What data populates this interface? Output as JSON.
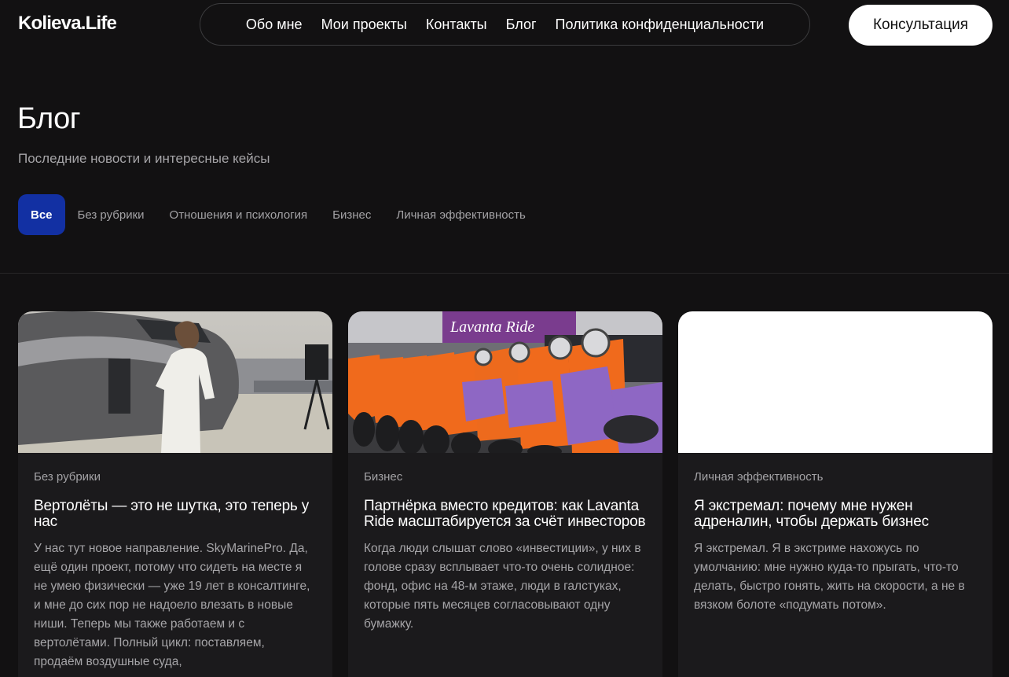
{
  "header": {
    "logo": "Kolieva.Life",
    "nav": [
      "Обо мне",
      "Мои проекты",
      "Контакты",
      "Блог",
      "Политика конфиденциальности"
    ],
    "cta": "Консультация"
  },
  "hero": {
    "title": "Блог",
    "subtitle": "Последние новости и интересные кейсы"
  },
  "filters": [
    "Все",
    "Без рубрики",
    "Отношения и психология",
    "Бизнес",
    "Личная эффективность"
  ],
  "active_filter": "Все",
  "posts": [
    {
      "category": "Без рубрики",
      "title": "Вертолёты — это не шутка, это теперь у нас",
      "excerpt": "У нас тут новое направление. SkyMarinePro. Да, ещё один проект, потому что сидеть на месте я не умею физически — уже 19 лет в консалтинге, и мне до сих пор не надоело влезать в новые ниши. Теперь мы также работаем и с вертолётами. Полный цикл: поставляем, продаём воздушные суда,"
    },
    {
      "category": "Бизнес",
      "title": "Партнёрка вместо кредитов: как Lavanta Ride масштабируется за счёт инвесторов",
      "excerpt": "Когда люди слышат слово «инвестиции», у них в голове сразу всплывает что-то очень солидное: фонд, офис на 48-м этаже, люди в галстуках, которые пять месяцев согласовывают одну бумажку.",
      "image_sign": "Lavanta Ride"
    },
    {
      "category": "Личная эффективность",
      "title": "Я экстремал: почему мне нужен адреналин, чтобы держать бизнес",
      "excerpt": "Я экстремал. Я в экстриме нахожусь по умолчанию: мне нужно куда-то прыгать, что-то делать, быстро гонять, жить на скорости, а не в вязком болоте «подумать потом»."
    }
  ],
  "colors": {
    "background": "#121112",
    "card": "#1b1a1c",
    "accent": "#1230a3",
    "scooter": "#f06a1c",
    "scooter_panel": "#8e67c4"
  }
}
